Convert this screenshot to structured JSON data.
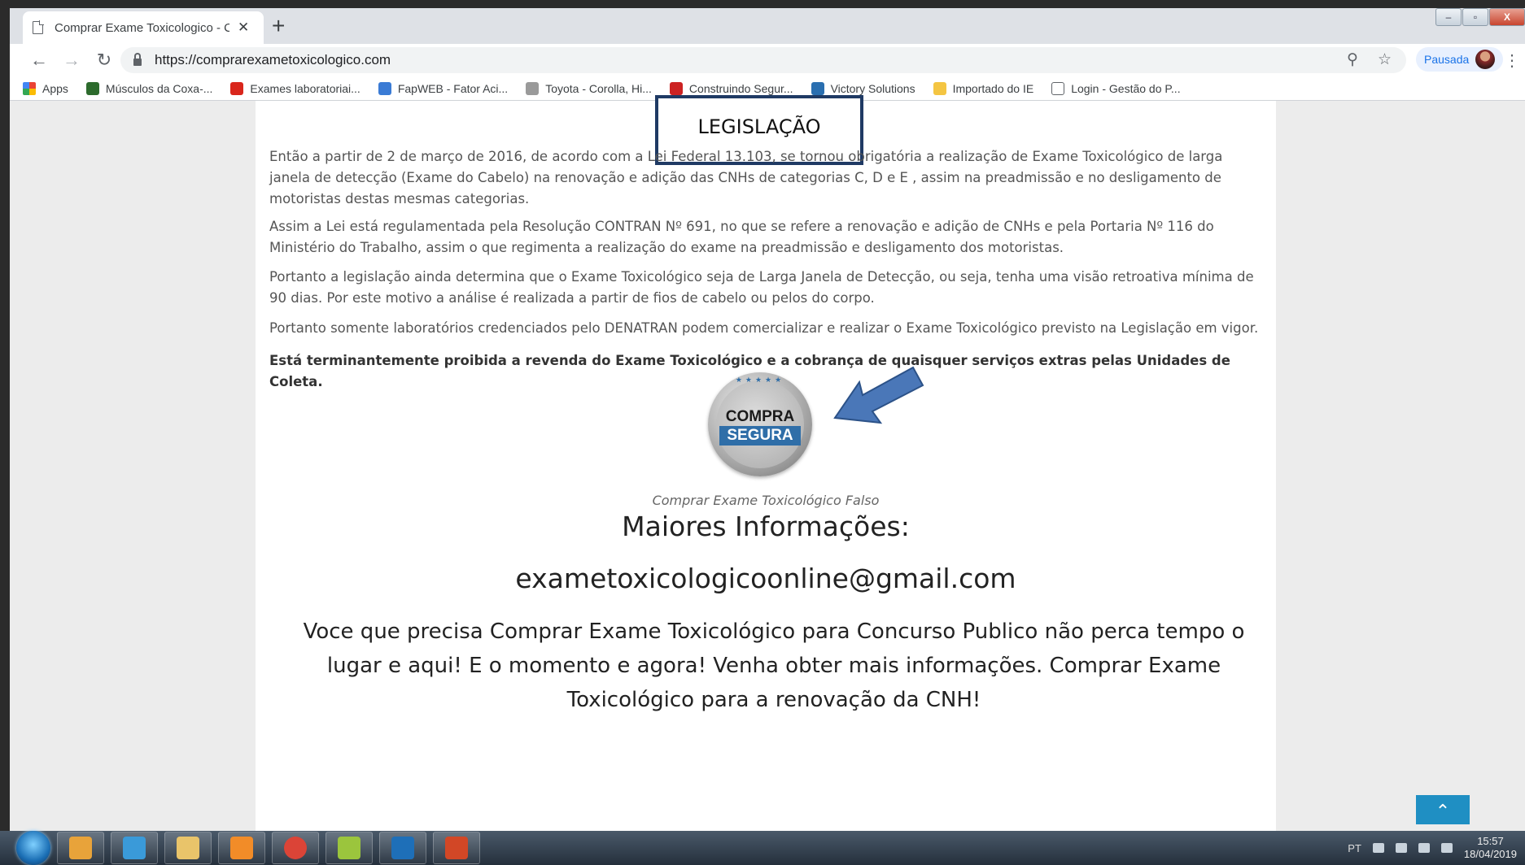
{
  "browser": {
    "tab_title": "Comprar Exame Toxicologico - C",
    "tab_close": "✕",
    "new_tab": "+",
    "url": "https://comprarexametoxicologico.com",
    "profile_label": "Pausada",
    "back": "←",
    "forward": "→",
    "reload": "↻",
    "zoom_icon": "⚲",
    "star_icon": "☆",
    "menu": "⋮",
    "win_min": "–",
    "win_max": "▫",
    "win_close": "X"
  },
  "bookmarks": [
    {
      "label": "Apps",
      "icon": "apps-grid-icon",
      "color": "#4285f4"
    },
    {
      "label": "Músculos da Coxa-...",
      "icon": "muscle-icon",
      "color": "#2d6b2d"
    },
    {
      "label": "Exames laboratoriai...",
      "icon": "lab-icon",
      "color": "#d9261c"
    },
    {
      "label": "FapWEB - Fator Aci...",
      "icon": "fapweb-icon",
      "color": "#3a7bd5"
    },
    {
      "label": "Toyota - Corolla, Hi...",
      "icon": "toyota-icon",
      "color": "#9a9a9a"
    },
    {
      "label": "Construindo Segur...",
      "icon": "construindo-icon",
      "color": "#cc2222"
    },
    {
      "label": "Victory Solutions",
      "icon": "victory-icon",
      "color": "#2a6fb0"
    },
    {
      "label": "Importado do IE",
      "icon": "folder-icon",
      "color": "#f4c542"
    },
    {
      "label": "Login - Gestão do P...",
      "icon": "page-icon",
      "color": "#ffffff"
    }
  ],
  "page": {
    "heading": "LEGISLAÇÃO",
    "paragraphs": [
      "Então a partir de 2 de março de 2016, de acordo com a Lei Federal 13.103, se tornou obrigatória a realização de Exame Toxicológico de larga janela de detecção (Exame do Cabelo) na renovação e adição das CNHs de categorias C, D e E , assim na preadmissão e no desligamento de motoristas destas mesmas categorias.",
      "Assim a Lei está regulamentada pela Resolução CONTRAN Nº 691, no que se refere a renovação e adição de CNHs e pela Portaria Nº 116 do Ministério do Trabalho, assim o que regimenta a realização do exame na preadmissão e desligamento dos motoristas.",
      "Portanto a legislação ainda determina que o Exame Toxicológico seja de Larga Janela de Detecção, ou seja, tenha uma visão retroativa mínima de 90 dias. Por este motivo a análise é realizada a partir de fios de cabelo ou pelos do corpo.",
      "Portanto somente laboratórios credenciados pelo DENATRAN podem comercializar e realizar o Exame Toxicológico previsto na Legislação em vigor."
    ],
    "warning": "Está terminantemente proibida a revenda do Exame Toxicológico e a cobrança de quaisquer serviços extras pelas Unidades de Coleta.",
    "badge_line1": "COMPRA",
    "badge_line2": "SEGURA",
    "badge_stars": "★★★★★",
    "caption": "Comprar Exame Toxicológico Falso",
    "more_info": "Maiores Informações:",
    "email": "exametoxicologicoonline@gmail.com",
    "cta": "Voce que precisa Comprar Exame Toxicológico para Concurso Publico não perca tempo o lugar e aqui! E o momento e agora! Venha obter mais informações.  Comprar Exame Toxicológico para a renovação da CNH!",
    "to_top": "⌃"
  },
  "taskbar": {
    "apps": [
      {
        "icon": "outlook-icon",
        "color": "#e8a33a"
      },
      {
        "icon": "internet-explorer-icon",
        "color": "#3a9ad9"
      },
      {
        "icon": "file-explorer-icon",
        "color": "#e9c46a"
      },
      {
        "icon": "media-player-icon",
        "color": "#f28c28"
      },
      {
        "icon": "chrome-icon",
        "color": "#db4437"
      },
      {
        "icon": "folder-app-icon",
        "color": "#9bc53d"
      },
      {
        "icon": "lync-icon",
        "color": "#1e6fb8"
      },
      {
        "icon": "powerpoint-icon",
        "color": "#d24726"
      }
    ],
    "language": "PT",
    "time": "15:57",
    "date": "18/04/2019"
  }
}
